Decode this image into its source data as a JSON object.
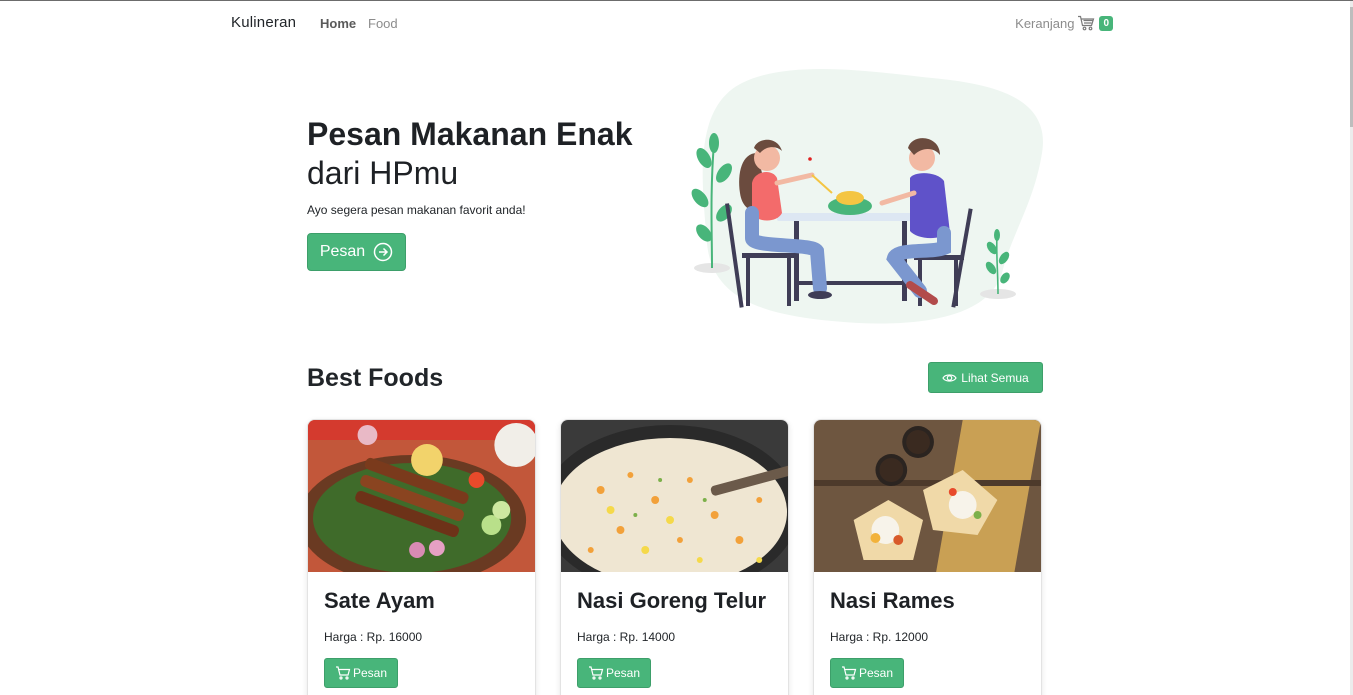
{
  "navbar": {
    "brand": "Kulineran",
    "links": [
      "Home",
      "Food"
    ],
    "cart_label": "Keranjang",
    "cart_count": "0",
    "cart_icon": "cart-icon"
  },
  "hero": {
    "title_line1": "Pesan Makanan Enak",
    "title_line2": "dari HPmu",
    "subtitle": "Ayo segera pesan makanan favorit anda!",
    "button_label": "Pesan",
    "button_icon": "arrow-right-circle-icon"
  },
  "best": {
    "title_normal": "Best",
    "title_bold": "Foods",
    "see_all_label": "Lihat Semua",
    "see_all_icon": "eye-icon"
  },
  "foods": [
    {
      "name": "Sate Ayam",
      "price": "Harga : Rp. 16000",
      "button": "Pesan"
    },
    {
      "name": "Nasi Goreng Telur",
      "price": "Harga : Rp. 14000",
      "button": "Pesan"
    },
    {
      "name": "Nasi Rames",
      "price": "Harga : Rp. 12000",
      "button": "Pesan"
    }
  ],
  "colors": {
    "accent": "#48b57a",
    "text": "#212529",
    "muted": "#8c8c8c"
  }
}
